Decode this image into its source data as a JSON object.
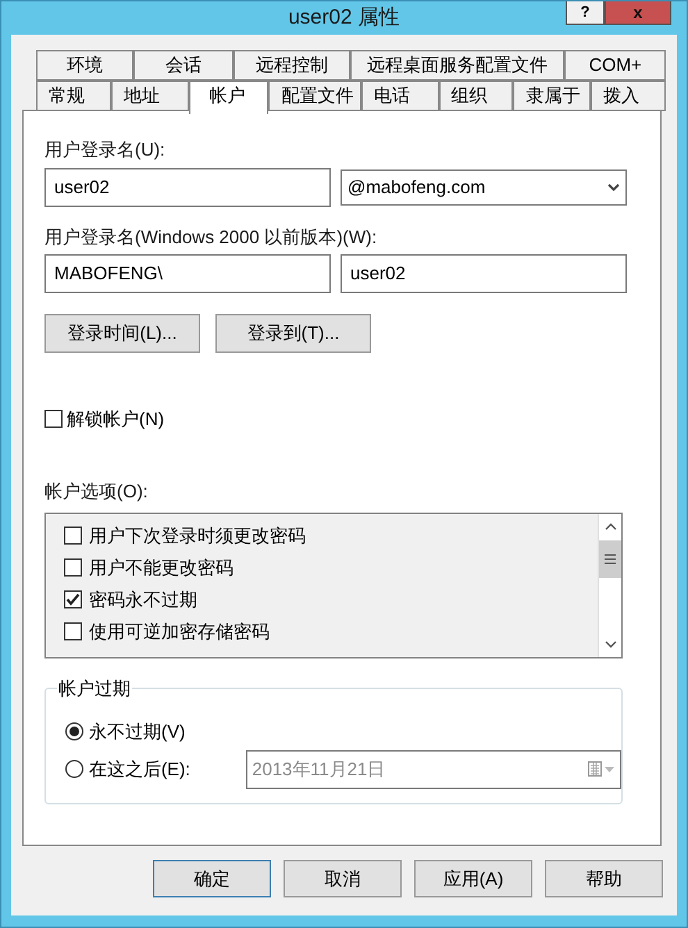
{
  "window": {
    "title": "user02 属性",
    "help_button": "?",
    "close_button": "x"
  },
  "tab_rows": [
    [
      {
        "label": "环境",
        "selected": false
      },
      {
        "label": "会话",
        "selected": false
      },
      {
        "label": "远程控制",
        "selected": false
      },
      {
        "label": "远程桌面服务配置文件",
        "selected": false
      },
      {
        "label": "COM+",
        "selected": false
      }
    ],
    [
      {
        "label": "常规",
        "selected": false
      },
      {
        "label": "地址",
        "selected": false
      },
      {
        "label": "帐户",
        "selected": true
      },
      {
        "label": "配置文件",
        "selected": false
      },
      {
        "label": "电话",
        "selected": false
      },
      {
        "label": "组织",
        "selected": false
      },
      {
        "label": "隶属于",
        "selected": false
      },
      {
        "label": "拨入",
        "selected": false
      }
    ]
  ],
  "logon_name": {
    "label": "用户登录名(U):",
    "value": "user02",
    "domain": "@mabofeng.com"
  },
  "legacy_logon_name": {
    "label": "用户登录名(Windows 2000 以前版本)(W):",
    "domain": "MABOFENG\\",
    "value": "user02"
  },
  "logon_buttons": [
    "登录时间(L)...",
    "登录到(T)..."
  ],
  "unlock": {
    "label": "解锁帐户(N)",
    "checked": false
  },
  "account_options": {
    "label": "帐户选项(O):",
    "items": [
      {
        "label": "用户下次登录时须更改密码",
        "checked": false
      },
      {
        "label": "用户不能更改密码",
        "checked": false
      },
      {
        "label": "密码永不过期",
        "checked": true
      },
      {
        "label": "使用可逆加密存储密码",
        "checked": false
      }
    ]
  },
  "account_expires": {
    "title": "帐户过期",
    "options": [
      {
        "label": "永不过期(V)",
        "selected": true
      },
      {
        "label": "在这之后(E):",
        "selected": false
      }
    ],
    "date": {
      "value": "2013年11月21日",
      "disabled": true
    }
  },
  "buttons": [
    {
      "label": "确定",
      "default": true
    },
    {
      "label": "取消",
      "default": false
    },
    {
      "label": "应用(A)",
      "default": false
    },
    {
      "label": "帮助",
      "default": false
    }
  ]
}
